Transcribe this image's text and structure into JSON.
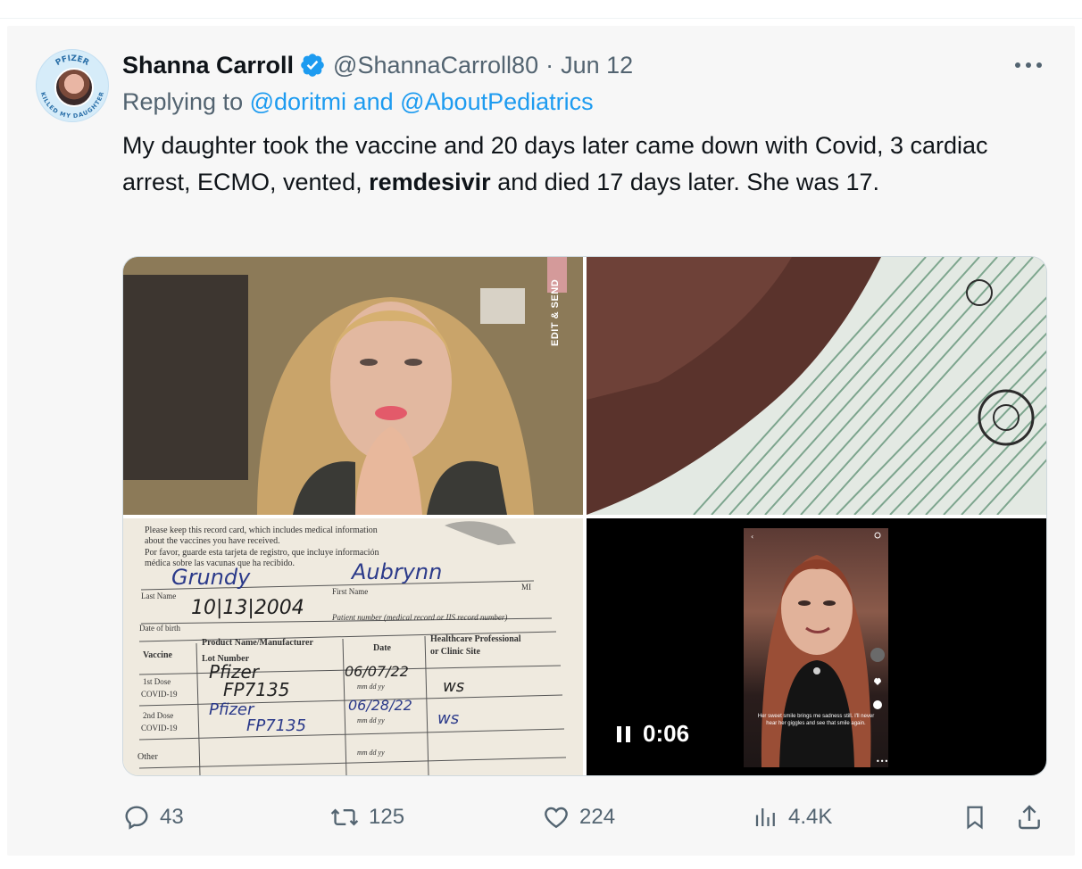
{
  "tweet": {
    "author": {
      "name": "Shanna Carroll",
      "handle": "@ShannaCarroll80",
      "date": "Jun 12",
      "verified": true,
      "avatar_ring_text_top": "PFIZER",
      "avatar_ring_text_bottom": "KILLED MY DAUGHTER"
    },
    "reply": {
      "prefix": "Replying to",
      "mention1": "@doritmi",
      "conjunction": "and",
      "mention2": "@AboutPediatrics"
    },
    "text": {
      "part1": "My daughter took the vaccine and 20 days later came down with Covid, 3 cardiac arrest, ECMO, vented, ",
      "bold": "remdesivir",
      "part2": " and died 17 days later. She was 17."
    },
    "media": {
      "photo1_overlay": "EDIT & SEND",
      "card": {
        "line1": "Please keep this record card, which includes medical information",
        "line2": "about the vaccines you have received.",
        "line3": "Por favor, guarde esta tarjeta de registro, que incluye información",
        "line4": "médica sobre las vacunas que ha recibido.",
        "last_name_label": "Last Name",
        "first_name_label": "First Name",
        "mi_label": "MI",
        "dob_label": "Date of birth",
        "patient_number_label": "Patient number (medical record or IIS record number)",
        "vaccine_col": "Vaccine",
        "product_col": "Product Name/Manufacturer",
        "lot_col": "Lot Number",
        "date_col": "Date",
        "hcp_col": "Healthcare Professional",
        "hcp_col2": "or Clinic Site",
        "dose1": "1st Dose",
        "dose1b": "COVID-19",
        "dose2": "2nd Dose",
        "dose2b": "COVID-19",
        "other": "Other",
        "mmddyy": "mm    dd    yy",
        "hand_last": "Grundy",
        "hand_first": "Aubrynn",
        "hand_dob": "10|13|2004",
        "hand_prod1": "Pfizer",
        "hand_lot1": "FP7135",
        "hand_date1": "06/07/22",
        "hand_site1": "ws",
        "hand_prod2": "Pfizer",
        "hand_lot2": "FP7135",
        "hand_date2": "06/28/22",
        "hand_site2": "ws"
      },
      "video": {
        "time": "0:06",
        "caption": "Her sweet smile brings me sadness still. I'll never hear her giggles and see that smile again."
      }
    },
    "actions": {
      "replies": "43",
      "reposts": "125",
      "likes": "224",
      "views": "4.4K"
    },
    "colors": {
      "link": "#1d9bf0",
      "muted": "#536471",
      "text": "#0f1419",
      "background": "#f7f7f7"
    }
  }
}
